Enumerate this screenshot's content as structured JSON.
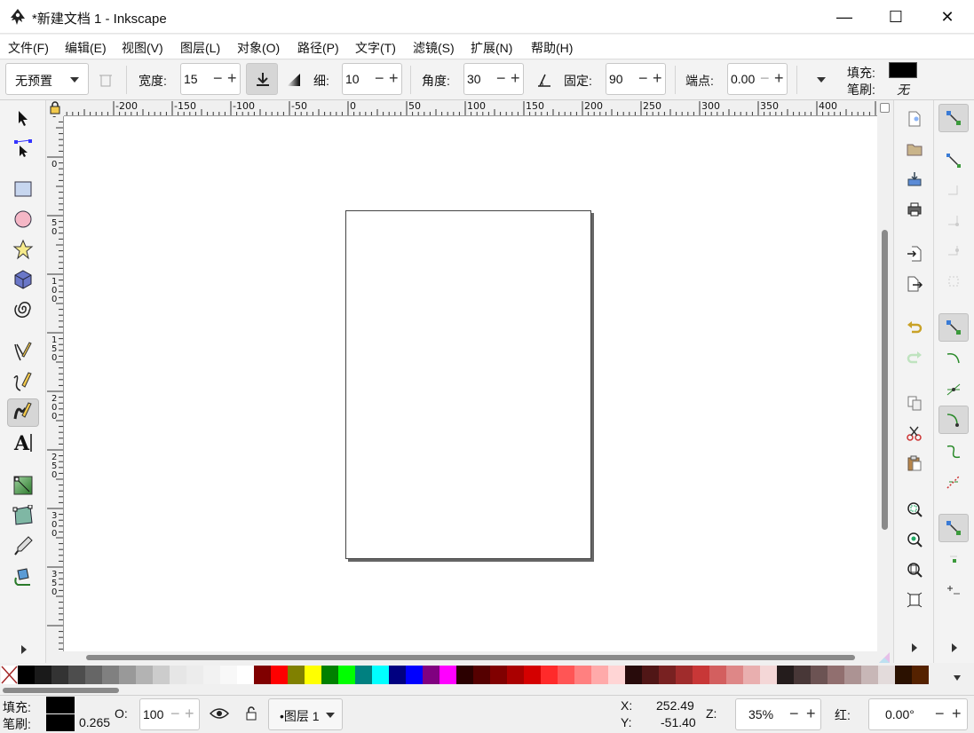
{
  "window": {
    "title": "*新建文档 1 - Inkscape",
    "minimize": "—",
    "maximize": "☐",
    "close": "✕"
  },
  "menu": [
    "文件(F)",
    "编辑(E)",
    "视图(V)",
    "图层(L)",
    "对象(O)",
    "路径(P)",
    "文字(T)",
    "滤镜(S)",
    "扩展(N)",
    "帮助(H)"
  ],
  "controls": {
    "preset": "无预置",
    "width_label": "宽度:",
    "width_value": "15",
    "thinning_label": "细:",
    "thinning_value": "10",
    "angle_label": "角度:",
    "angle_value": "30",
    "fixation_label": "固定:",
    "fixation_value": "90",
    "caps_label": "端点:",
    "caps_value": "0.00",
    "fill_label": "填充:",
    "stroke_label": "笔刷:",
    "stroke_value": "无",
    "fill_color": "#000000"
  },
  "ruler_top": [
    "-200",
    "-150",
    "-100",
    "-50",
    "0",
    "50",
    "100",
    "150",
    "200",
    "250",
    "300",
    "350",
    "400"
  ],
  "ruler_left": [
    "5\n0",
    "0",
    "5\n0",
    "1\n0\n0",
    "1\n5\n0",
    "2\n0\n0",
    "2\n5\n0",
    "3\n0\n0",
    "3\n5\n0"
  ],
  "tools": [
    "selector-tool",
    "node-tool",
    "rectangle-tool",
    "ellipse-tool",
    "star-tool",
    "3d-box-tool",
    "spiral-tool",
    "pencil-tool",
    "pen-tool",
    "calligraphy-tool",
    "text-tool",
    "gradient-tool",
    "mesh-tool",
    "dropper-tool",
    "paint-bucket-tool"
  ],
  "palette": [
    "#000000",
    "#1a1a1a",
    "#333333",
    "#4d4d4d",
    "#666666",
    "#808080",
    "#999999",
    "#b3b3b3",
    "#cccccc",
    "#e6e6e6",
    "#ececec",
    "#f2f2f2",
    "#f8f8f8",
    "#ffffff",
    "#800000",
    "#ff0000",
    "#808000",
    "#ffff00",
    "#008000",
    "#00ff00",
    "#008080",
    "#00ffff",
    "#000080",
    "#0000ff",
    "#800080",
    "#ff00ff",
    "#2b0000",
    "#550000",
    "#800000",
    "#aa0000",
    "#d40000",
    "#ff2a2a",
    "#ff5555",
    "#ff8080",
    "#ffaaaa",
    "#ffd5d5",
    "#280b0b",
    "#501616",
    "#782121",
    "#a02c2c",
    "#c83737",
    "#d35f5f",
    "#de8787",
    "#e9afaf",
    "#f4d7d7",
    "#241c1c",
    "#483737",
    "#6c5353",
    "#916f6f",
    "#ac9393",
    "#c8b7b7",
    "#e3dbdb",
    "#2b1100",
    "#552200"
  ],
  "status": {
    "fill_label": "填充:",
    "stroke_label": "笔刷:",
    "stroke_width": "0.265",
    "opacity_label": "O:",
    "opacity_value": "100",
    "layer": "•图层 1",
    "x_label": "X:",
    "x_value": "252.49",
    "y_label": "Y:",
    "y_value": "-51.40",
    "zoom_label": "Z:",
    "zoom_value": "35%",
    "rotate_label": "红:",
    "rotate_value": "0.00°"
  }
}
